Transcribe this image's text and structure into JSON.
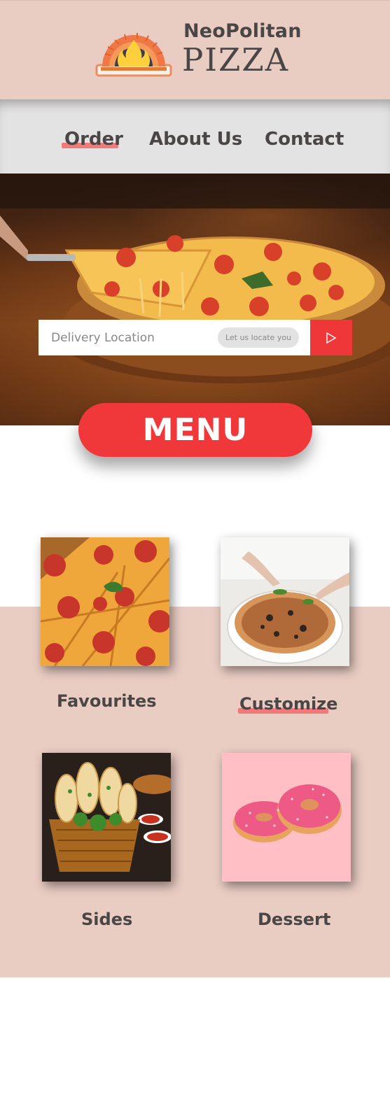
{
  "brand": {
    "name_top": "NeoPolitan",
    "name_bottom": "PIZZA",
    "logo_icon": "pizza-oven-icon"
  },
  "nav": {
    "items": [
      {
        "label": "Order",
        "active": true
      },
      {
        "label": "About Us",
        "active": false
      },
      {
        "label": "Contact",
        "active": false
      }
    ]
  },
  "search": {
    "placeholder": "Delivery Location",
    "value": "",
    "locate_label": "Let us locate you",
    "submit_icon": "play-arrow-icon"
  },
  "menu_label": "MENU",
  "categories": [
    {
      "label": "Favourites",
      "image": "pepperoni-pizza-image",
      "highlighted": false
    },
    {
      "label": "Customize",
      "image": "topping-pizza-image",
      "highlighted": true
    },
    {
      "label": "Sides",
      "image": "garlic-bread-basket-image",
      "highlighted": false
    },
    {
      "label": "Dessert",
      "image": "pink-donuts-image",
      "highlighted": false
    }
  ],
  "colors": {
    "header_bg": "#e9cdc3",
    "nav_bg": "#e4e3e3",
    "accent_red": "#f0373a",
    "underline": "#f07a7a",
    "text": "#4a4646",
    "dessert_bg": "#ffbfc4"
  }
}
